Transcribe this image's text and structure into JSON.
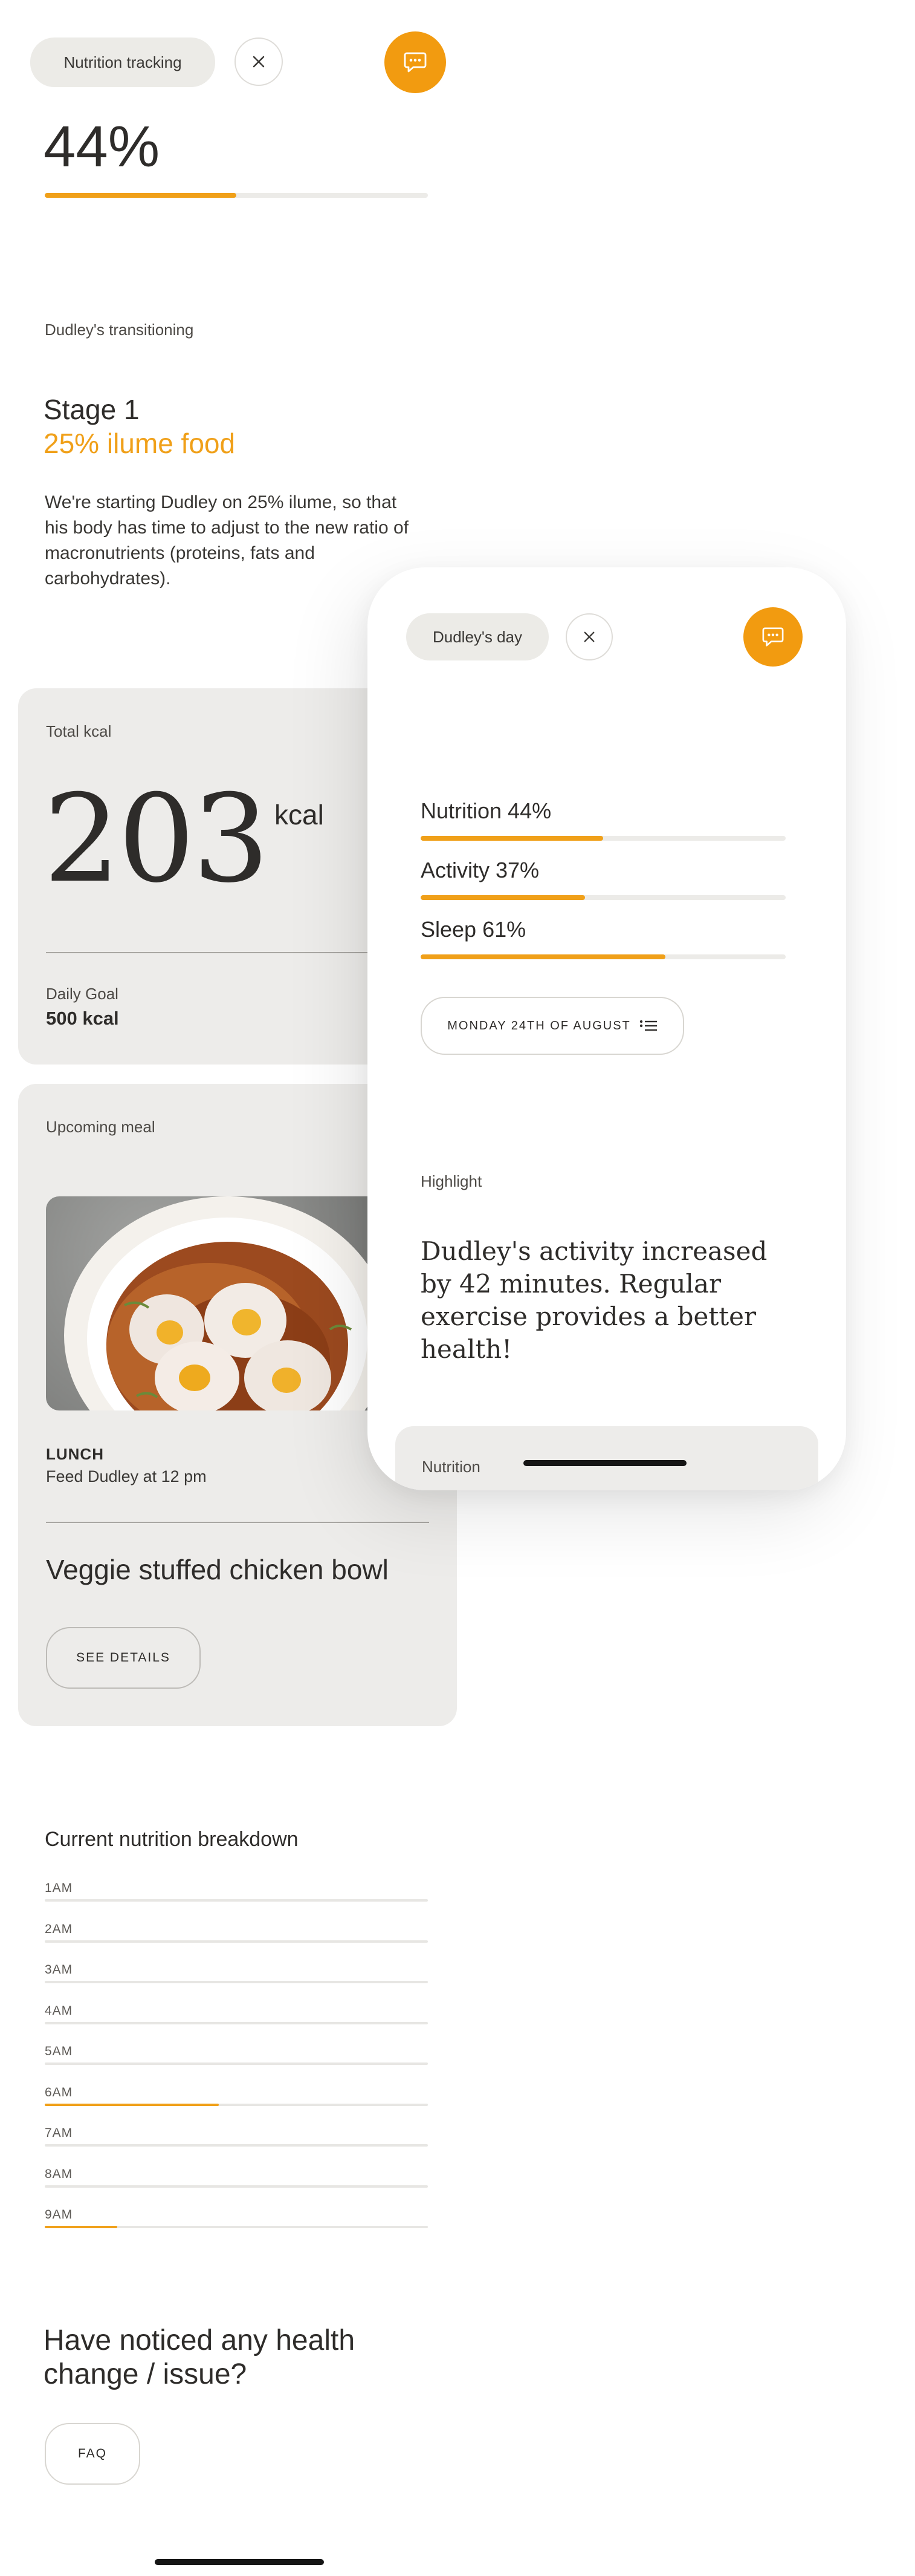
{
  "header": {
    "chip_label": "Nutrition tracking",
    "close_icon": "close-icon",
    "chat_icon": "chat-icon",
    "accent_color": "#f29b10"
  },
  "progress": {
    "percent_label": "44%",
    "value": 0.5
  },
  "transition": {
    "eyebrow": "Dudley's transitioning",
    "stage_title": "Stage 1",
    "stage_subtitle": "25% ilume food",
    "description": "We're starting Dudley on 25% ilume, so that his body has time to adjust to the new ratio of macronutrients (proteins, fats and carbohydrates)."
  },
  "kcal_card": {
    "label": "Total kcal",
    "value": "203",
    "unit": "kcal",
    "goal_label": "Daily Goal",
    "goal_value": "500 kcal"
  },
  "meal_card": {
    "label": "Upcoming meal",
    "meal_type": "LUNCH",
    "meal_time": "Feed Dudley at 12 pm",
    "meal_name": "Veggie stuffed chicken bowl",
    "details_button": "SEE DETAILS"
  },
  "breakdown": {
    "title": "Current nutrition breakdown",
    "rows": [
      {
        "label": "1AM",
        "fill": 0
      },
      {
        "label": "2AM",
        "fill": 0
      },
      {
        "label": "3AM",
        "fill": 0
      },
      {
        "label": "4AM",
        "fill": 0
      },
      {
        "label": "5AM",
        "fill": 0
      },
      {
        "label": "6AM",
        "fill": 0.455
      },
      {
        "label": "7AM",
        "fill": 0
      },
      {
        "label": "8AM",
        "fill": 0
      },
      {
        "label": "9AM",
        "fill": 0.19
      }
    ]
  },
  "faq_section": {
    "title": "Have noticed any health change / issue?",
    "button": "FAQ"
  },
  "phone": {
    "chip_label": "Dudley's day",
    "close_icon": "close-icon",
    "chat_icon": "chat-icon",
    "metrics": [
      {
        "label": "Nutrition 44%",
        "value": 0.5
      },
      {
        "label": "Activity 37%",
        "value": 0.45
      },
      {
        "label": "Sleep 61%",
        "value": 0.67
      }
    ],
    "date_button": "MONDAY 24TH OF AUGUST",
    "date_icon": "list-icon",
    "highlight_label": "Highlight",
    "highlight_text": "Dudley's activity increased by 42 minutes. Regular exercise provides a better health!",
    "bottom_card_label": "Nutrition"
  }
}
